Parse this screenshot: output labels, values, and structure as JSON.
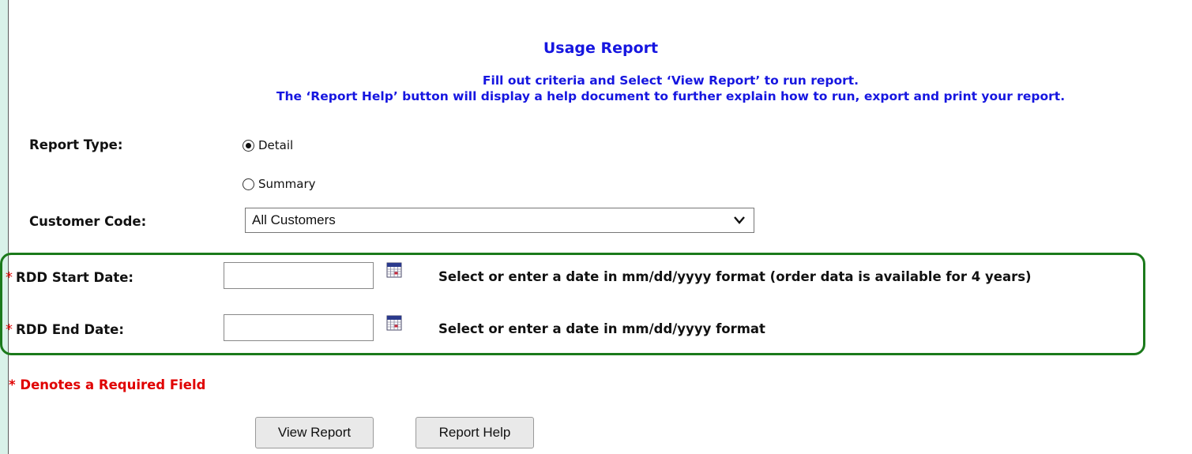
{
  "page": {
    "title": "Usage Report",
    "instruction_line1": "Fill out criteria and Select ‘View Report’ to run report.",
    "instruction_line2": "The ‘Report Help’ button will display a help document to further explain how to run, export and print your report."
  },
  "form": {
    "report_type": {
      "label": "Report Type:",
      "options": [
        {
          "label": "Detail",
          "checked": true
        },
        {
          "label": "Summary",
          "checked": false
        }
      ]
    },
    "customer_code": {
      "label": "Customer Code:",
      "selected": "All Customers"
    },
    "required_marker": "*",
    "rdd_start": {
      "label": "RDD Start Date:",
      "value": "",
      "hint": "Select or enter a date in mm/dd/yyyy format (order data is available for 4 years)"
    },
    "rdd_end": {
      "label": "RDD End Date:",
      "value": "",
      "hint": "Select or enter a date in mm/dd/yyyy format"
    },
    "required_note": "* Denotes a Required Field"
  },
  "buttons": {
    "view_report": "View Report",
    "report_help": "Report Help"
  },
  "colors": {
    "heading_blue": "#1616e0",
    "required_red": "#e00000",
    "highlight_green": "#1b7a1b",
    "background_mint": "#d9f2e9"
  },
  "icons": {
    "calendar": "calendar-icon",
    "dropdown": "chevron-down-icon"
  }
}
